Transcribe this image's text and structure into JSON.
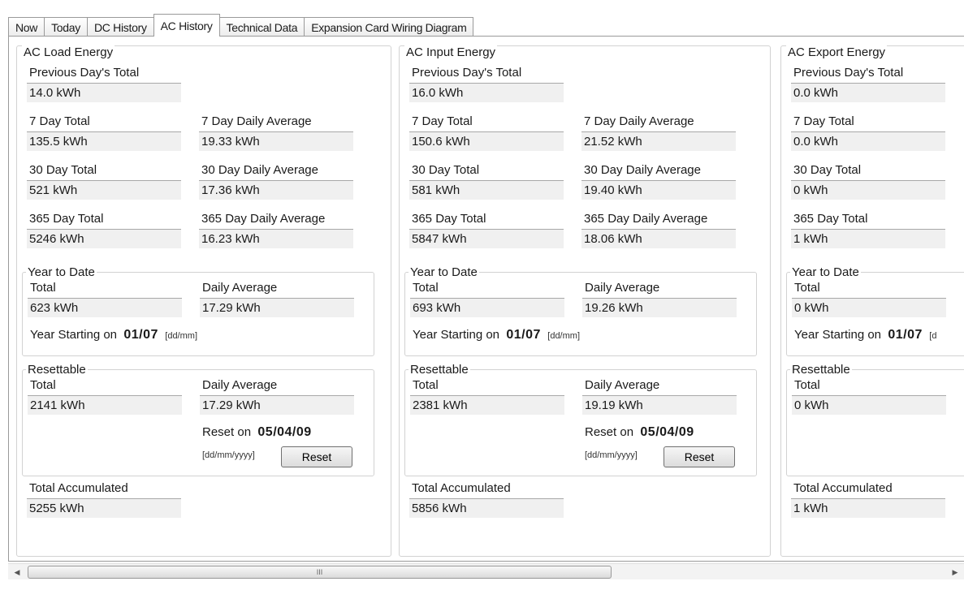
{
  "tabs": [
    {
      "label": "Now"
    },
    {
      "label": "Today"
    },
    {
      "label": "DC History"
    },
    {
      "label": "AC History"
    },
    {
      "label": "Technical Data"
    },
    {
      "label": "Expansion Card Wiring Diagram"
    }
  ],
  "active_tab": "AC History",
  "labels": {
    "prev_day_total": "Previous Day's Total",
    "seven_day_total": "7 Day Total",
    "seven_day_avg": "7 Day Daily Average",
    "thirty_day_total": "30 Day Total",
    "thirty_day_avg": "30 Day Daily Average",
    "year_day_total": "365 Day Total",
    "year_day_avg": "365 Day Daily Average",
    "ytd_title": "Year to Date",
    "total": "Total",
    "daily_average": "Daily Average",
    "year_starting_on": "Year Starting on",
    "year_start_value": "01/07",
    "dd_mm": "[dd/mm]",
    "dd_mm_partial": "[d",
    "resettable_title": "Resettable",
    "reset_on": "Reset on",
    "reset_date": "05/04/09",
    "dd_mm_yyyy": "[dd/mm/yyyy]",
    "reset_button": "Reset",
    "total_accumulated": "Total Accumulated"
  },
  "load": {
    "title": "AC Load Energy",
    "prev_day_total": "14.0 kWh",
    "seven_day_total": "135.5 kWh",
    "seven_day_avg": "19.33 kWh",
    "thirty_day_total": "521 kWh",
    "thirty_day_avg": "17.36 kWh",
    "year_day_total": "5246 kWh",
    "year_day_avg": "16.23 kWh",
    "ytd_total": "623 kWh",
    "ytd_avg": "17.29 kWh",
    "reset_total": "2141 kWh",
    "reset_avg": "17.29 kWh",
    "total_accumulated": "5255 kWh"
  },
  "input": {
    "title": "AC Input Energy",
    "prev_day_total": "16.0 kWh",
    "seven_day_total": "150.6 kWh",
    "seven_day_avg": "21.52 kWh",
    "thirty_day_total": "581 kWh",
    "thirty_day_avg": "19.40 kWh",
    "year_day_total": "5847 kWh",
    "year_day_avg": "18.06 kWh",
    "ytd_total": "693 kWh",
    "ytd_avg": "19.26 kWh",
    "reset_total": "2381 kWh",
    "reset_avg": "19.19 kWh",
    "total_accumulated": "5856 kWh"
  },
  "export": {
    "title": "AC Export Energy",
    "prev_day_total": "0.0 kWh",
    "seven_day_total": "0.0 kWh",
    "thirty_day_total": "0 kWh",
    "year_day_total": "1 kWh",
    "ytd_total": "0 kWh",
    "reset_total": "0 kWh",
    "total_accumulated": "1 kWh"
  },
  "scrollbar": {
    "left_arrow": "◀",
    "right_arrow": "▶",
    "grip": "III"
  }
}
